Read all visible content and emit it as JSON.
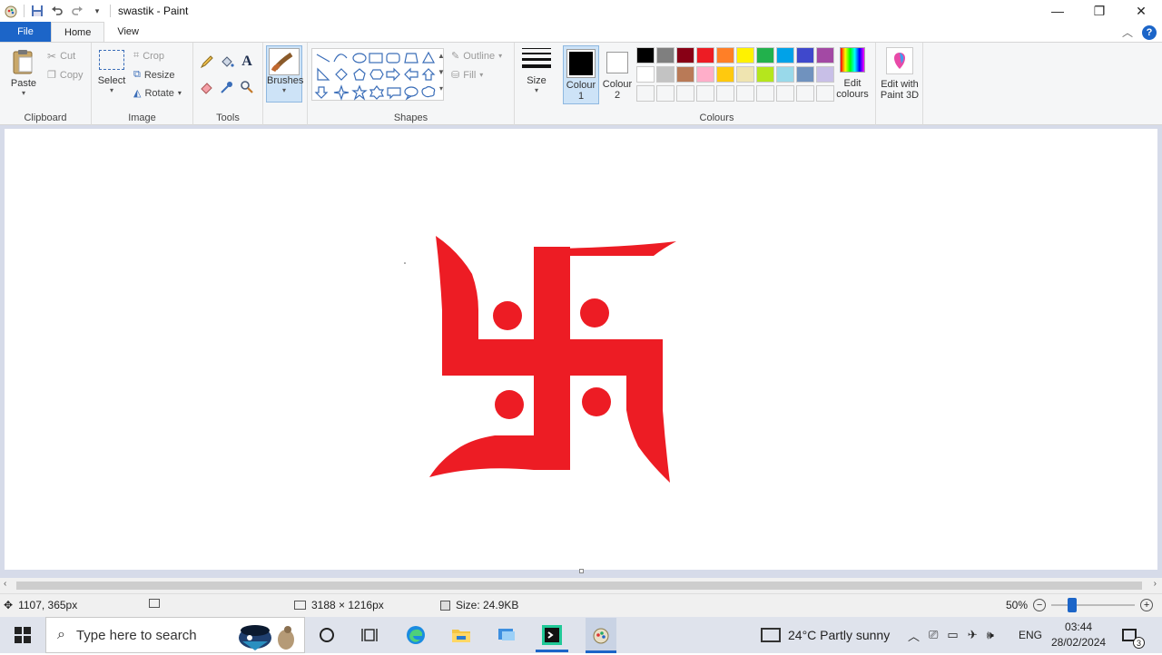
{
  "window": {
    "title": "swastik - Paint",
    "controls": {
      "minimize": "—",
      "maximize": "❐",
      "close": "✕"
    }
  },
  "tabs": {
    "file": "File",
    "home": "Home",
    "view": "View"
  },
  "clipboard": {
    "paste": "Paste",
    "cut": "Cut",
    "copy": "Copy",
    "label": "Clipboard"
  },
  "image": {
    "select": "Select",
    "crop": "Crop",
    "resize": "Resize",
    "rotate": "Rotate",
    "label": "Image"
  },
  "tools": {
    "label": "Tools"
  },
  "brushes": {
    "label": "Brushes"
  },
  "shapes": {
    "outline": "Outline",
    "fill": "Fill",
    "label": "Shapes"
  },
  "size": {
    "label": "Size"
  },
  "colours": {
    "colour1": "Colour",
    "colour1_num": "1",
    "colour2": "Colour",
    "colour2_num": "2",
    "edit": "Edit",
    "edit2": "colours",
    "paint3d": "Edit with",
    "paint3d2": "Paint 3D",
    "label": "Colours",
    "row1": [
      "#000000",
      "#7f7f7f",
      "#880015",
      "#ed1c24",
      "#ff7f27",
      "#fff200",
      "#22b14c",
      "#00a2e8",
      "#3f48cc",
      "#a349a4"
    ],
    "row2": [
      "#ffffff",
      "#c3c3c3",
      "#b97a57",
      "#ffaec9",
      "#ffc90e",
      "#efe4b0",
      "#b5e61d",
      "#99d9ea",
      "#7092be",
      "#c8bfe7"
    ],
    "swastika_color": "#ed1c24"
  },
  "status": {
    "cursor": "1107, 365px",
    "dimensions": "3188 × 1216px",
    "size": "Size: 24.9KB",
    "zoom": "50%"
  },
  "taskbar": {
    "search_placeholder": "Type here to search",
    "weather": "24°C  Partly sunny",
    "language": "ENG",
    "time": "03:44",
    "date": "28/02/2024",
    "notifications": "3"
  }
}
